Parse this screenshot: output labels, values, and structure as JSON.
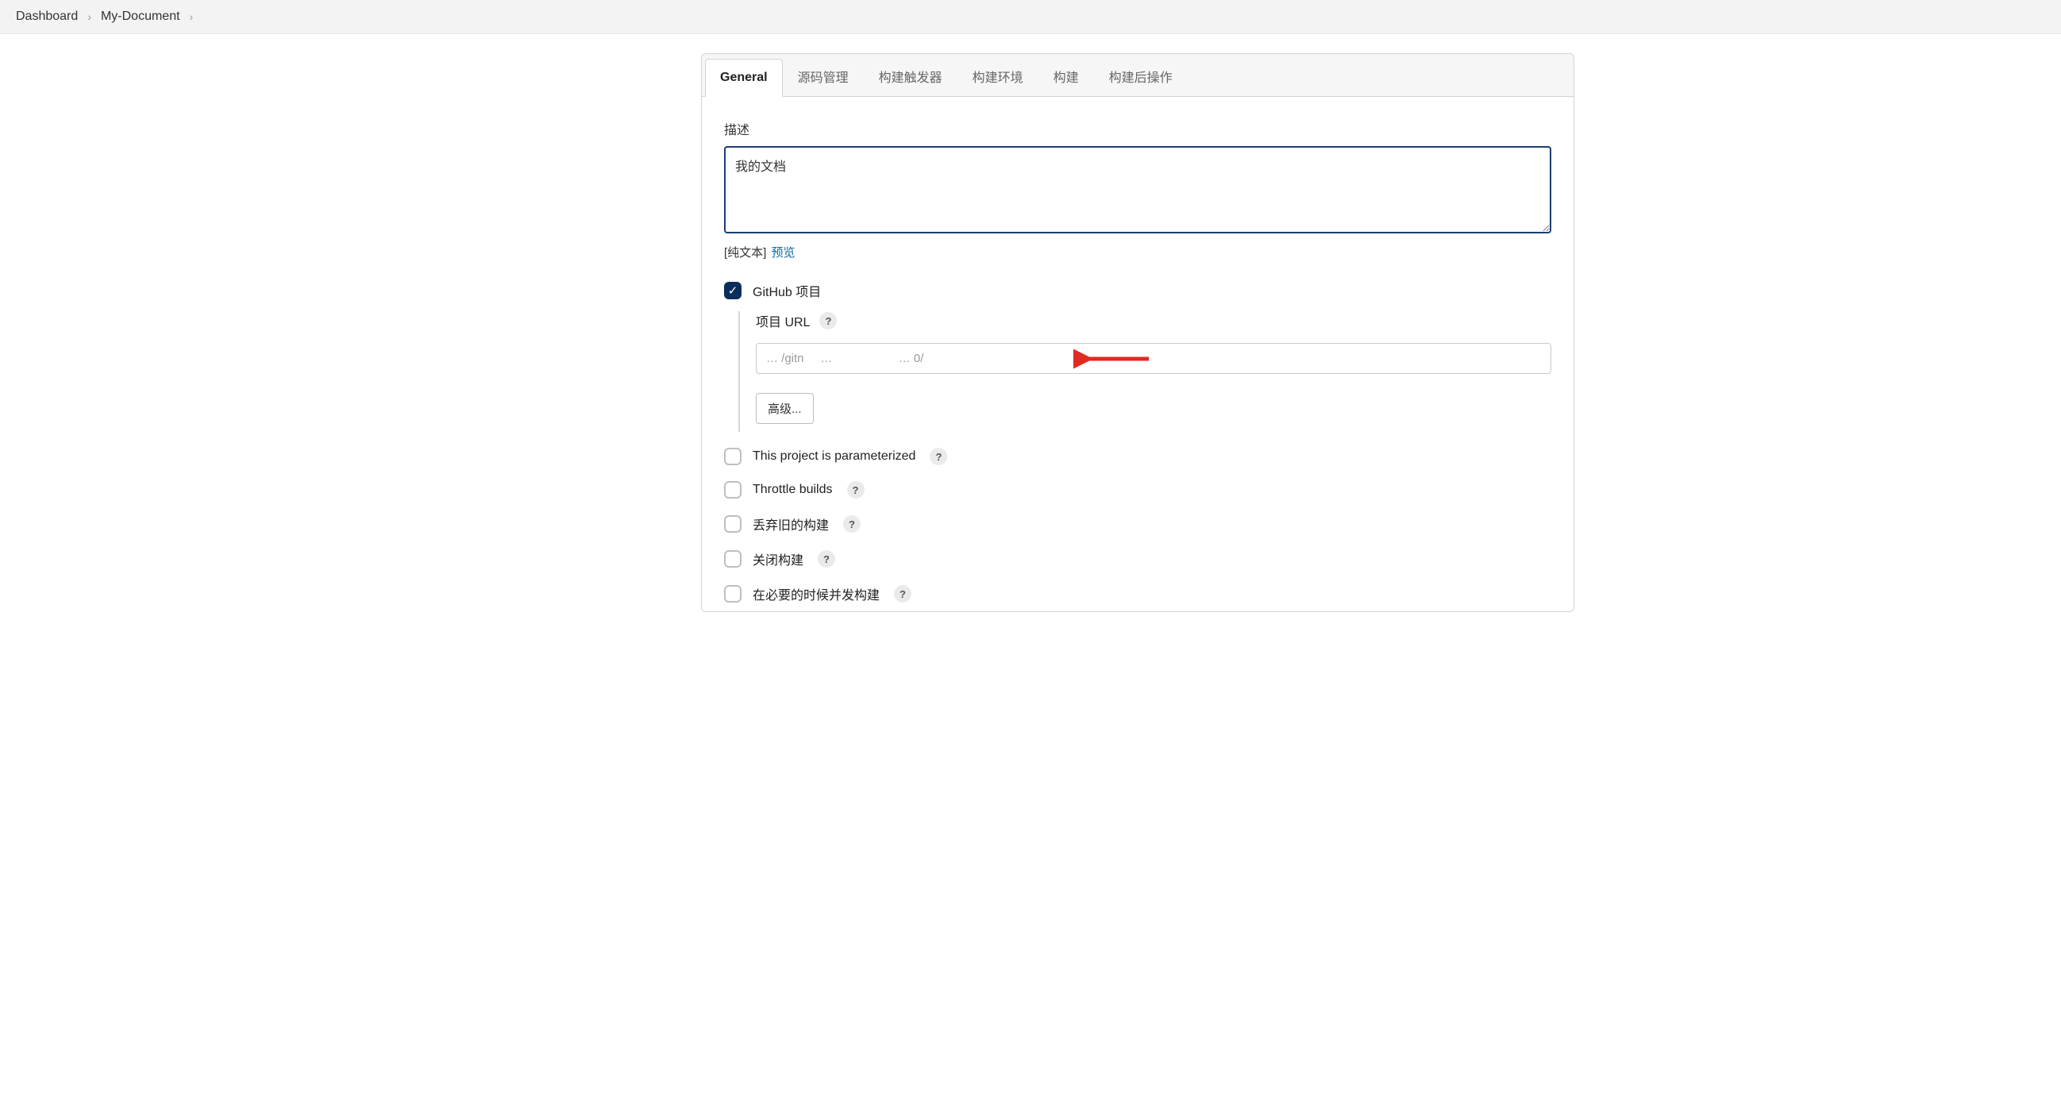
{
  "breadcrumb": {
    "items": [
      "Dashboard",
      "My-Document"
    ]
  },
  "tabs": [
    {
      "label": "General",
      "active": true
    },
    {
      "label": "源码管理",
      "active": false
    },
    {
      "label": "构建触发器",
      "active": false
    },
    {
      "label": "构建环境",
      "active": false
    },
    {
      "label": "构建",
      "active": false
    },
    {
      "label": "构建后操作",
      "active": false
    }
  ],
  "description": {
    "label": "描述",
    "value": "我的文档",
    "plain_text_label": "[纯文本]",
    "preview_label": "预览"
  },
  "github": {
    "checkbox_label": "GitHub 项目",
    "checked": true,
    "url_label": "项目 URL",
    "url_value": "… /gitn     …                    … 0/",
    "advanced_button": "高级..."
  },
  "options": [
    {
      "label": "This project is parameterized",
      "help": true
    },
    {
      "label": "Throttle builds",
      "help": true
    },
    {
      "label": "丢弃旧的构建",
      "help": true
    },
    {
      "label": "关闭构建",
      "help": true
    },
    {
      "label": "在必要的时候并发构建",
      "help": true
    }
  ],
  "help_symbol": "?"
}
